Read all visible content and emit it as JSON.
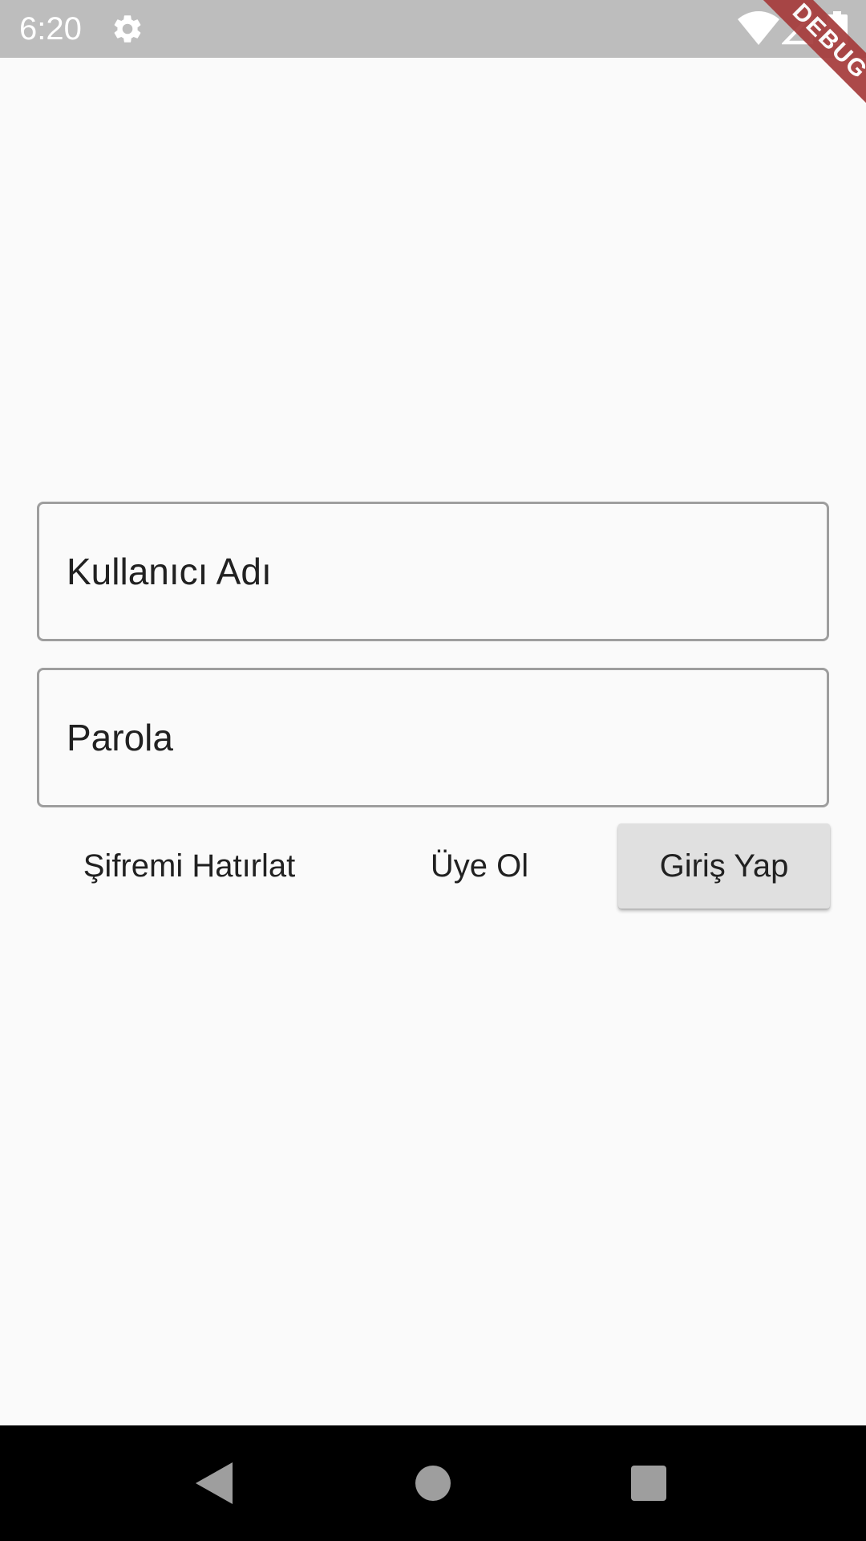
{
  "status_bar": {
    "time": "6:20",
    "icons": [
      "gear-icon",
      "wifi-icon",
      "signal-icon",
      "battery-icon"
    ]
  },
  "debug_banner": "DEBUG",
  "form": {
    "username_placeholder": "Kullanıcı Adı",
    "password_placeholder": "Parola"
  },
  "actions": {
    "forgot_password": "Şifremi Hatırlat",
    "register": "Üye Ol",
    "login": "Giriş Yap"
  },
  "navigation": {
    "icons": [
      "back-icon",
      "home-icon",
      "recents-icon"
    ]
  },
  "colors": {
    "status_bar": "#bdbdbd",
    "background": "#fafafa",
    "field_border": "#9e9e9e",
    "login_button": "#e0e0e0",
    "debug_ribbon": "#a63b3b",
    "nav_bar": "#000000"
  }
}
